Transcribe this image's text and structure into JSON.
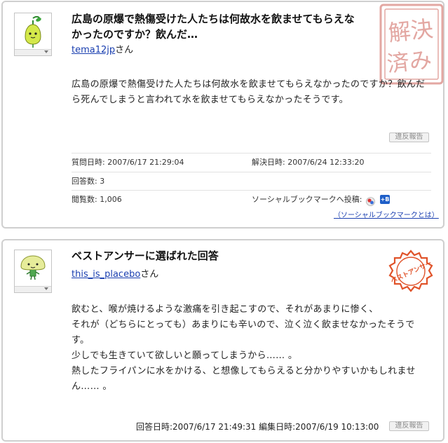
{
  "question": {
    "title": "広島の原爆で熱傷受けた人たちは何故水を飲ませてもらえなかったのですか？飲んだ…",
    "user": "tema12jp",
    "user_suffix": "さん",
    "body": "広島の原爆で熱傷受けた人たちは何故水を飲ませてもらえなかったのですか？飲んだら死んでしまうと言われて水を飲ませてもらえなかったそうです。",
    "report_label": "違反報告",
    "stamp_text": "解決済み",
    "meta": {
      "asked_label": "質問日時:",
      "asked_value": "2007/6/17 21:29:04",
      "solved_label": "解決日時:",
      "solved_value": "2007/6/24 12:33:20",
      "answers_label": "回答数:",
      "answers_value": "3",
      "views_label": "閲覧数:",
      "views_value": "1,006",
      "social_label": "ソーシャルブックマークへ投稿:",
      "social_icon_2_label": "+B",
      "social_link": "（ソーシャルブックマークとは）"
    }
  },
  "answer": {
    "title": "ベストアンサーに選ばれた回答",
    "user": "this_is_placebo",
    "user_suffix": "さん",
    "paragraph_1_line_1": "飲むと、喉が焼けるような激痛を引き起こすので、それがあまりに惨く、",
    "paragraph_1_line_2": "それが（どちらにとっても）あまりにも辛いので、泣く泣く飲ませなかったそうです。",
    "paragraph_1_line_3": "少しでも生きていて欲しいと願ってしまうから…… 。",
    "paragraph_2": "熱したフライパンに水をかける、と想像してもらえると分かりやすいかもしれません…… 。",
    "stamp_text": "ベストアンサー",
    "answered_label": "回答日時:",
    "answered_value": "2007/6/17 21:49:31",
    "edited_label": "編集日時:",
    "edited_value": "2007/6/19 10:13:00",
    "report_label": "違反報告"
  },
  "colors": {
    "link": "#1a3fb0",
    "stamp_solved": "#e3a7a2",
    "stamp_best": "#e0532a",
    "border": "#cfcfcf"
  },
  "icons": {
    "question_avatar": "sprout-character-icon",
    "answer_avatar": "mushroom-character-icon",
    "avatar_menu": "chevron-down-icon"
  }
}
